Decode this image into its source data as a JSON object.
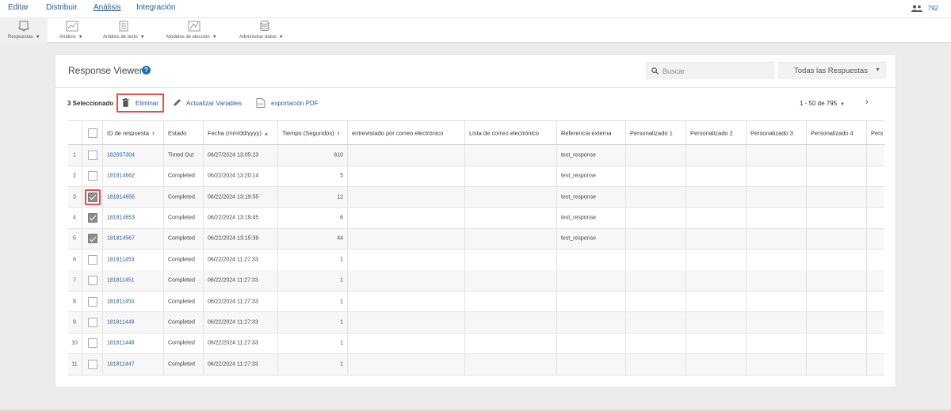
{
  "topnav": {
    "tabs": [
      {
        "label": "Editar"
      },
      {
        "label": "Distribuir"
      },
      {
        "label": "Análisis"
      },
      {
        "label": "Integración"
      }
    ],
    "user_count": "792"
  },
  "toolbar": {
    "items": [
      {
        "label": "Respuestas",
        "icon": "responses-icon"
      },
      {
        "label": "Análisis",
        "icon": "analysis-chart-icon"
      },
      {
        "label": "Análisis de texto",
        "icon": "text-analysis-icon"
      },
      {
        "label": "Modelos de elección",
        "icon": "choice-models-icon"
      },
      {
        "label": "Administrar datos",
        "icon": "database-icon"
      }
    ]
  },
  "viewer": {
    "title": "Response Viewer",
    "search_placeholder": "Buscar",
    "filter_value": "Todas las Respuestas"
  },
  "actions": {
    "selected_count": "3 Seleccionado",
    "delete_label": "Eliminar",
    "update_vars_label": "Actualizar Variables",
    "export_pdf_label": "exportación PDF",
    "pagination": "1 - 50 de 795"
  },
  "table": {
    "columns": [
      "ID de respuesta",
      "Estado",
      "Fecha (mm/dd/yyyy)",
      "Tiempo (Segundos)",
      "entrevistado por correo electrónico",
      "Lista de correo electrónico",
      "Referencia externa",
      "Personalizado 1",
      "Personalizado 2",
      "Personalizado 3",
      "Personalizado 4",
      "Pers"
    ],
    "rows": [
      {
        "n": "1",
        "checked": false,
        "id": "182007304",
        "status": "Timed Out",
        "date": "06/27/2024 13:05:23",
        "time": "610",
        "ext": "test_response"
      },
      {
        "n": "2",
        "checked": false,
        "id": "181814662",
        "status": "Completed",
        "date": "06/22/2024 13:20:14",
        "time": "5",
        "ext": "test_response"
      },
      {
        "n": "3",
        "checked": true,
        "id": "181814656",
        "status": "Completed",
        "date": "06/22/2024 13:19:55",
        "time": "12",
        "ext": "test_response"
      },
      {
        "n": "4",
        "checked": true,
        "id": "181814653",
        "status": "Completed",
        "date": "06/22/2024 13:19:45",
        "time": "6",
        "ext": "test_response"
      },
      {
        "n": "5",
        "checked": true,
        "id": "181814567",
        "status": "Completed",
        "date": "06/22/2024 13:15:39",
        "time": "44",
        "ext": "test_response"
      },
      {
        "n": "6",
        "checked": false,
        "id": "181811453",
        "status": "Completed",
        "date": "06/22/2024 11:27:33",
        "time": "1",
        "ext": ""
      },
      {
        "n": "7",
        "checked": false,
        "id": "181811451",
        "status": "Completed",
        "date": "06/22/2024 11:27:33",
        "time": "1",
        "ext": ""
      },
      {
        "n": "8",
        "checked": false,
        "id": "181811450",
        "status": "Completed",
        "date": "06/22/2024 11:27:33",
        "time": "1",
        "ext": ""
      },
      {
        "n": "9",
        "checked": false,
        "id": "181811449",
        "status": "Completed",
        "date": "06/22/2024 11:27:33",
        "time": "1",
        "ext": ""
      },
      {
        "n": "10",
        "checked": false,
        "id": "181811448",
        "status": "Completed",
        "date": "06/22/2024 11:27:33",
        "time": "1",
        "ext": ""
      },
      {
        "n": "11",
        "checked": false,
        "id": "181811447",
        "status": "Completed",
        "date": "06/22/2024 11:27:33",
        "time": "1",
        "ext": ""
      }
    ]
  },
  "colors": {
    "link": "#1f5f9c",
    "highlight": "#d9534f",
    "checked": "#8c8c8c"
  }
}
